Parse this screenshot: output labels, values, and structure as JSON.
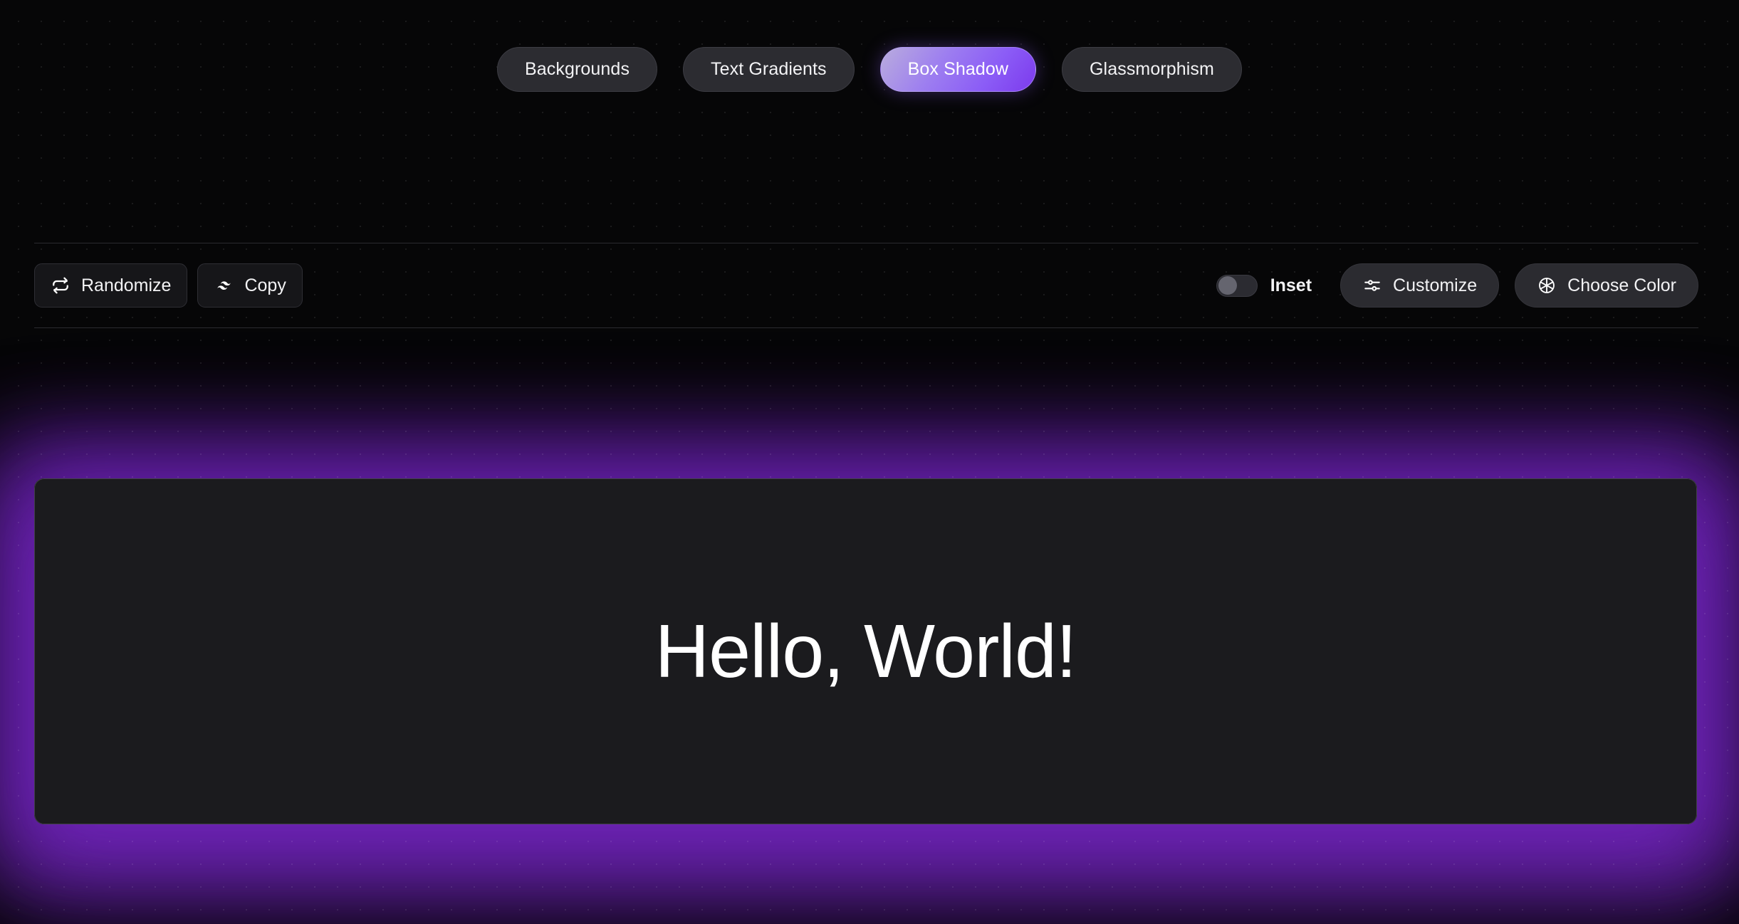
{
  "tabs": [
    {
      "label": "Backgrounds",
      "active": false
    },
    {
      "label": "Text Gradients",
      "active": false
    },
    {
      "label": "Box Shadow",
      "active": true
    },
    {
      "label": "Glassmorphism",
      "active": false
    }
  ],
  "toolbar": {
    "randomize_label": "Randomize",
    "copy_label": "Copy",
    "inset_label": "Inset",
    "inset_enabled": false,
    "customize_label": "Customize",
    "choose_color_label": "Choose Color"
  },
  "preview": {
    "text": "Hello, World!"
  },
  "icons": {
    "randomize": "refresh-cycle-icon",
    "copy": "layers-icon",
    "customize": "sliders-icon",
    "choose_color": "color-wheel-icon"
  },
  "colors": {
    "page_background": "#060607",
    "accent_start": "#b9acdd",
    "accent_end": "#7c3aed",
    "glow": "#7c28d2",
    "card_background": "#1b1b1e",
    "card_border": "#414147",
    "button_background": "#161619",
    "pill_background": "#2b2b30",
    "text_primary": "#f2f2f4"
  }
}
